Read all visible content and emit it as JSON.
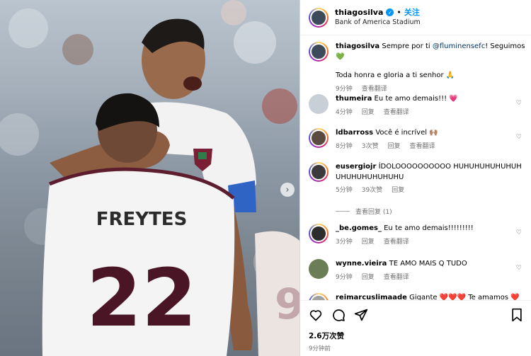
{
  "post": {
    "username": "thiagosilva",
    "follow_label": "关注",
    "location": "Bank of America Stadium",
    "jersey": {
      "name": "FREYTES",
      "number": "22"
    }
  },
  "caption": {
    "username": "thiagosilva",
    "line1_pre": "Sempre por ti ",
    "mention": "@fluminensefc",
    "line1_post": "! Seguimos 💚",
    "line2": "Toda honra e gloria a ti senhor 🙏",
    "time": "9分钟",
    "translate": "查看翻译"
  },
  "comments": [
    {
      "username": "thumeira",
      "text": "Eu te amo demais!!! 💗",
      "time": "4分钟",
      "likes": "",
      "reply": "回复",
      "translate": "查看翻译",
      "avatar_color": "#c9cfd6"
    },
    {
      "username": "ldbarross",
      "text": "Você é incrível 🙌🏽",
      "time": "8分钟",
      "likes": "3次赞",
      "reply": "回复",
      "translate": "查看翻译",
      "avatar_color": "#5a4a3f"
    },
    {
      "username": "eusergiojr",
      "text": "ÍDOLOOOOOOOOOO HUHUHUHUHUHUHUHUHUHUHUHUHU",
      "time": "5分钟",
      "likes": "39次赞",
      "reply": "回复",
      "translate": "",
      "avatar_color": "#3c3a3d",
      "view_replies": "查看回复 (1)"
    },
    {
      "username": "_be.gomes_",
      "text": "Eu te amo demais!!!!!!!!!",
      "time": "3分钟",
      "likes": "",
      "reply": "回复",
      "translate": "查看翻译",
      "avatar_color": "#2d2d2d"
    },
    {
      "username": "wynne.vieira",
      "text": "TE AMO MAIS Q TUDO",
      "time": "9分钟",
      "likes": "",
      "reply": "回复",
      "translate": "查看翻译",
      "avatar_color": "#6b7d56"
    },
    {
      "username": "reimarcuslimaade",
      "text": "Gigante ❤️❤️❤️ Te amamos ❤️",
      "time": "",
      "likes": "",
      "reply": "",
      "translate": "",
      "avatar_color": "#a0a0a0"
    }
  ],
  "footer": {
    "likes": "2.6万次赞",
    "time": "9分钟前"
  },
  "colors": {
    "accent": "#0095f6",
    "like_heart": "#ff3040"
  }
}
